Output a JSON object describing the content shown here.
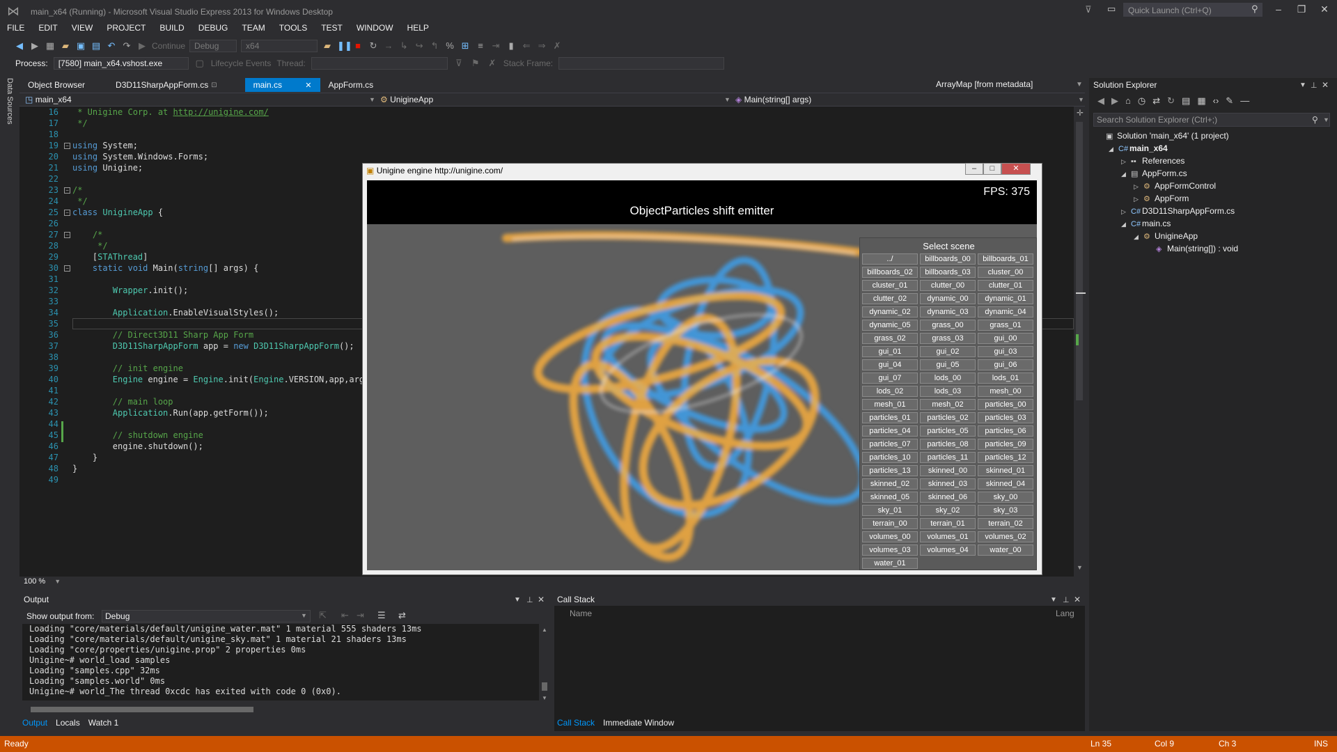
{
  "window": {
    "title": "main_x64 (Running) - Microsoft Visual Studio Express 2013 for Windows Desktop",
    "quick_launch_placeholder": "Quick Launch (Ctrl+Q)"
  },
  "menu": [
    "FILE",
    "EDIT",
    "VIEW",
    "PROJECT",
    "BUILD",
    "DEBUG",
    "TEAM",
    "TOOLS",
    "TEST",
    "WINDOW",
    "HELP"
  ],
  "toolbar": {
    "continue": "Continue",
    "config": "Debug",
    "platform": "x64"
  },
  "debug_bar": {
    "process_label": "Process:",
    "process_value": "[7580] main_x64.vshost.exe",
    "lifecycle": "Lifecycle Events",
    "thread_label": "Thread:",
    "stack_frame_label": "Stack Frame:"
  },
  "left_strip": {
    "data_sources": "Data Sources"
  },
  "tabs": {
    "object_browser": "Object Browser",
    "d3d": "D3D11SharpAppForm.cs",
    "main": "main.cs",
    "appform": "AppForm.cs",
    "arraymap": "ArrayMap [from metadata]"
  },
  "nav": {
    "project": "main_x64",
    "class": "UnigineApp",
    "member": "Main(string[] args)"
  },
  "editor": {
    "zoom": "100 %",
    "line_numbers": [
      "16",
      "17",
      "18",
      "19",
      "20",
      "21",
      "22",
      "23",
      "24",
      "25",
      "26",
      "27",
      "28",
      "29",
      "30",
      "31",
      "32",
      "33",
      "34",
      "35",
      "36",
      "37",
      "38",
      "39",
      "40",
      "41",
      "42",
      "43",
      "44",
      "45",
      "46",
      "47",
      "48",
      "49"
    ],
    "lines": [
      [
        {
          "c": "cm",
          "t": " * Unigine Corp. at "
        },
        {
          "c": "lnk",
          "t": "http://unigine.com/"
        }
      ],
      [
        {
          "c": "cm",
          "t": " */"
        }
      ],
      [
        {
          "c": "",
          "t": ""
        }
      ],
      [
        {
          "c": "kw",
          "t": "using"
        },
        {
          "c": "",
          "t": " System;"
        }
      ],
      [
        {
          "c": "kw",
          "t": "using"
        },
        {
          "c": "",
          "t": " System.Windows.Forms;"
        }
      ],
      [
        {
          "c": "kw",
          "t": "using"
        },
        {
          "c": "",
          "t": " Unigine;"
        }
      ],
      [
        {
          "c": "",
          "t": ""
        }
      ],
      [
        {
          "c": "cm",
          "t": "/*"
        }
      ],
      [
        {
          "c": "cm",
          "t": " */"
        }
      ],
      [
        {
          "c": "kw",
          "t": "class"
        },
        {
          "c": "",
          "t": " "
        },
        {
          "c": "cls",
          "t": "UnigineApp"
        },
        {
          "c": "",
          "t": " {"
        }
      ],
      [
        {
          "c": "",
          "t": ""
        }
      ],
      [
        {
          "c": "cm",
          "t": "    /*"
        }
      ],
      [
        {
          "c": "cm",
          "t": "     */"
        }
      ],
      [
        {
          "c": "",
          "t": "    ["
        },
        {
          "c": "cls",
          "t": "STAThread"
        },
        {
          "c": "",
          "t": "]"
        }
      ],
      [
        {
          "c": "kw",
          "t": "    static void"
        },
        {
          "c": "",
          "t": " Main("
        },
        {
          "c": "kw",
          "t": "string"
        },
        {
          "c": "",
          "t": "[] args) {"
        }
      ],
      [
        {
          "c": "",
          "t": ""
        }
      ],
      [
        {
          "c": "cls",
          "t": "        Wrapper"
        },
        {
          "c": "",
          "t": ".init();"
        }
      ],
      [
        {
          "c": "",
          "t": ""
        }
      ],
      [
        {
          "c": "cls",
          "t": "        Application"
        },
        {
          "c": "",
          "t": ".EnableVisualStyles();"
        }
      ],
      [
        {
          "c": "",
          "t": ""
        }
      ],
      [
        {
          "c": "cm",
          "t": "        // Direct3D11 Sharp App Form"
        }
      ],
      [
        {
          "c": "cls",
          "t": "        D3D11SharpAppForm"
        },
        {
          "c": "",
          "t": " app = "
        },
        {
          "c": "kw",
          "t": "new"
        },
        {
          "c": "",
          "t": " "
        },
        {
          "c": "cls",
          "t": "D3D11SharpAppForm"
        },
        {
          "c": "",
          "t": "();"
        }
      ],
      [
        {
          "c": "",
          "t": ""
        }
      ],
      [
        {
          "c": "cm",
          "t": "        // init engine"
        }
      ],
      [
        {
          "c": "cls",
          "t": "        Engine"
        },
        {
          "c": "",
          "t": " engine = "
        },
        {
          "c": "cls",
          "t": "Engine"
        },
        {
          "c": "",
          "t": ".init("
        },
        {
          "c": "cls",
          "t": "Engine"
        },
        {
          "c": "",
          "t": ".VERSION,app,args"
        }
      ],
      [
        {
          "c": "",
          "t": ""
        }
      ],
      [
        {
          "c": "cm",
          "t": "        // main loop"
        }
      ],
      [
        {
          "c": "cls",
          "t": "        Application"
        },
        {
          "c": "",
          "t": ".Run(app.getForm());"
        }
      ],
      [
        {
          "c": "",
          "t": ""
        }
      ],
      [
        {
          "c": "cm",
          "t": "        // shutdown engine"
        }
      ],
      [
        {
          "c": "",
          "t": "        engine.shutdown();"
        }
      ],
      [
        {
          "c": "",
          "t": "    }"
        }
      ],
      [
        {
          "c": "",
          "t": "}"
        }
      ],
      [
        {
          "c": "",
          "t": ""
        }
      ]
    ]
  },
  "output": {
    "title": "Output",
    "show_from_label": "Show output from:",
    "show_from_value": "Debug",
    "lines": [
      "Loading \"core/materials/default/unigine_water.mat\" 1 material 555 shaders 13ms",
      "Loading \"core/materials/default/unigine_sky.mat\" 1 material 21 shaders 13ms",
      "Loading \"core/properties/unigine.prop\" 2 properties 0ms",
      "Unigine~# world_load samples",
      "Loading \"samples.cpp\" 32ms",
      "Loading \"samples.world\" 0ms",
      "Unigine~# world_The thread 0xcdc has exited with code 0 (0x0)."
    ],
    "tabs": [
      "Output",
      "Locals",
      "Watch 1"
    ]
  },
  "callstack": {
    "title": "Call Stack",
    "col_name": "Name",
    "col_lang": "Lang",
    "tabs": [
      "Call Stack",
      "Immediate Window"
    ]
  },
  "solution": {
    "title": "Solution Explorer",
    "search_placeholder": "Search Solution Explorer (Ctrl+;)",
    "items": [
      {
        "label": "Solution 'main_x64' (1 project)",
        "indent": 0,
        "arrow": "",
        "icon": "▣"
      },
      {
        "label": "main_x64",
        "indent": 1,
        "arrow": "◢",
        "icon": "C#",
        "bold": true
      },
      {
        "label": "References",
        "indent": 2,
        "arrow": "▷",
        "icon": "▪▪"
      },
      {
        "label": "AppForm.cs",
        "indent": 2,
        "arrow": "◢",
        "icon": "▤"
      },
      {
        "label": "AppFormControl",
        "indent": 3,
        "arrow": "▷",
        "icon": "⚙"
      },
      {
        "label": "AppForm",
        "indent": 3,
        "arrow": "▷",
        "icon": "⚙"
      },
      {
        "label": "D3D11SharpAppForm.cs",
        "indent": 2,
        "arrow": "▷",
        "icon": "C#"
      },
      {
        "label": "main.cs",
        "indent": 2,
        "arrow": "◢",
        "icon": "C#"
      },
      {
        "label": "UnigineApp",
        "indent": 3,
        "arrow": "◢",
        "icon": "⚙"
      },
      {
        "label": "Main(string[]) : void",
        "indent": 4,
        "arrow": "",
        "icon": "◈"
      }
    ]
  },
  "status": {
    "ready": "Ready",
    "ln": "Ln 35",
    "col": "Col 9",
    "ch": "Ch 3",
    "ins": "INS"
  },
  "engine": {
    "title": "Unigine engine http://unigine.com/",
    "fps": "FPS: 375",
    "heading": "ObjectParticles shift emitter",
    "select_scene": "Select scene",
    "scenes": [
      "../",
      "billboards_00",
      "billboards_01",
      "billboards_02",
      "billboards_03",
      "cluster_00",
      "cluster_01",
      "clutter_00",
      "clutter_01",
      "clutter_02",
      "dynamic_00",
      "dynamic_01",
      "dynamic_02",
      "dynamic_03",
      "dynamic_04",
      "dynamic_05",
      "grass_00",
      "grass_01",
      "grass_02",
      "grass_03",
      "gui_00",
      "gui_01",
      "gui_02",
      "gui_03",
      "gui_04",
      "gui_05",
      "gui_06",
      "gui_07",
      "lods_00",
      "lods_01",
      "lods_02",
      "lods_03",
      "mesh_00",
      "mesh_01",
      "mesh_02",
      "particles_00",
      "particles_01",
      "particles_02",
      "particles_03",
      "particles_04",
      "particles_05",
      "particles_06",
      "particles_07",
      "particles_08",
      "particles_09",
      "particles_10",
      "particles_11",
      "particles_12",
      "particles_13",
      "skinned_00",
      "skinned_01",
      "skinned_02",
      "skinned_03",
      "skinned_04",
      "skinned_05",
      "skinned_06",
      "sky_00",
      "sky_01",
      "sky_02",
      "sky_03",
      "terrain_00",
      "terrain_01",
      "terrain_02",
      "volumes_00",
      "volumes_01",
      "volumes_02",
      "volumes_03",
      "volumes_04",
      "water_00",
      "water_01"
    ]
  },
  "colors": {
    "accent": "#007acc",
    "status": "#ca5100",
    "editor_bg": "#1e1e1e",
    "chrome": "#2d2d30",
    "particle_orange": "#ffb23c",
    "particle_blue": "#3aa8ff"
  }
}
